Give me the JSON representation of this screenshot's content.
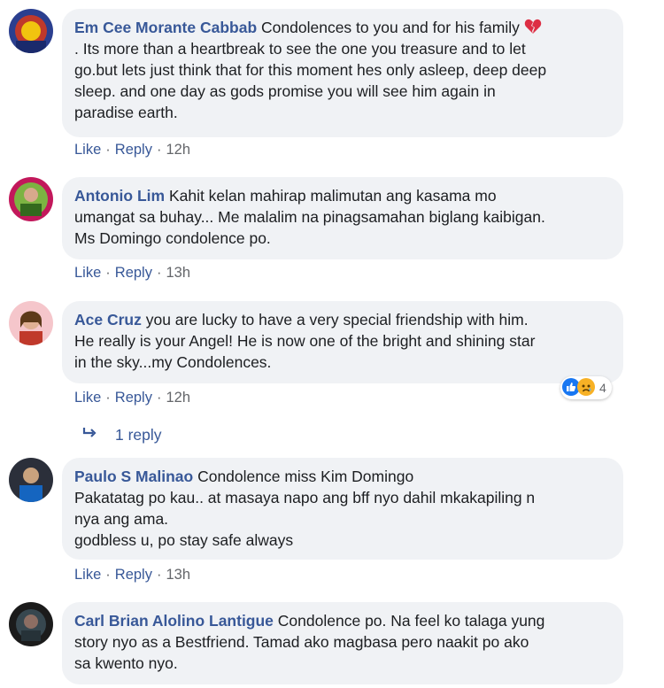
{
  "comments": [
    {
      "author": "Em Cee Morante Cabbab",
      "lines": [
        "Condolences to you and for his family",
        ". Its more than a heartbreak to see the one you treasure and to let",
        "go.but lets just think that for this moment hes only asleep, deep deep",
        "sleep. and one day as gods promise you will see him again in",
        "paradise earth."
      ],
      "emoji": "broken-heart-icon",
      "like": "Like",
      "reply": "Reply",
      "time": "12h"
    },
    {
      "author": "Antonio Lim",
      "lines": [
        "Kahit kelan mahirap malimutan ang kasama mo",
        "umangat sa buhay... Me malalim na pinagsamahan biglang kaibigan.",
        "Ms Domingo condolence po."
      ],
      "like": "Like",
      "reply": "Reply",
      "time": "13h"
    },
    {
      "author": "Ace Cruz",
      "lines": [
        "you are lucky to have a very special friendship with him.",
        "He really is your Angel! He is now one of the bright and shining star",
        "in the sky...my Condolences."
      ],
      "like": "Like",
      "reply": "Reply",
      "time": "12h",
      "reaction_count": "4",
      "replies_label": "1 reply"
    },
    {
      "author": "Paulo S Malinao",
      "lines": [
        "Condolence miss Kim Domingo",
        "Pakatatag po kau.. at masaya napo ang bff nyo dahil mkakapiling n",
        "nya ang ama.",
        "godbless u, po stay safe always"
      ],
      "like": "Like",
      "reply": "Reply",
      "time": "13h"
    },
    {
      "author": "Carl Brian Alolino Lantigue",
      "lines": [
        "Condolence po. Na feel ko talaga yung",
        "story nyo as a Bestfriend. Tamad ako magbasa pero naakit po ako",
        "sa kwento nyo."
      ]
    }
  ],
  "colors": {
    "link": "#385898",
    "bubble": "#f0f2f5",
    "meta": "#65676b"
  }
}
